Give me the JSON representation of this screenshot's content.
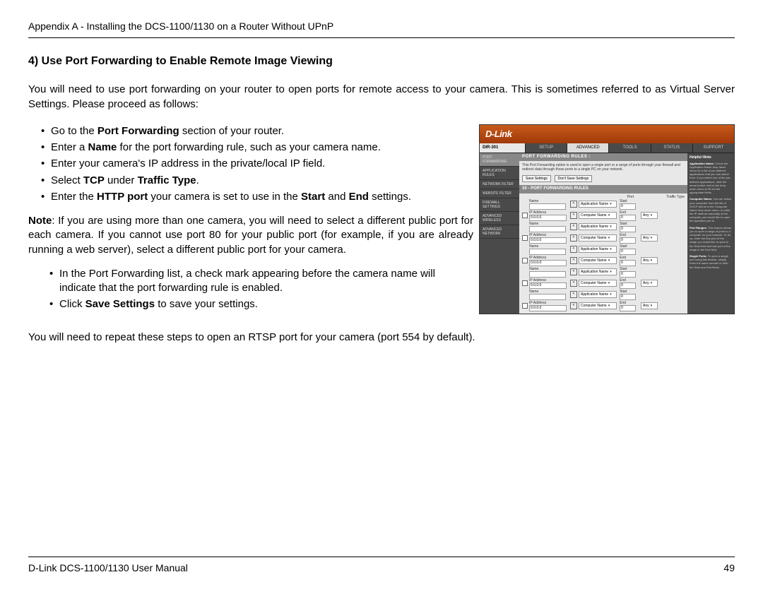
{
  "header": {
    "appendix": "Appendix A - Installing the DCS-1100/1130 on a Router Without UPnP"
  },
  "section": {
    "title": "4) Use Port Forwarding to Enable Remote Image Viewing",
    "intro": "You will need to use port forwarding on your router to open ports for remote access to your camera. This is sometimes referred to as Virtual Server Settings. Please proceed as follows:",
    "b1_pre": "Go to the ",
    "b1_bold": "Port Forwarding",
    "b1_post": " section of your router.",
    "b2_pre": "Enter a ",
    "b2_bold": "Name",
    "b2_post": " for the port forwarding rule, such as your camera name.",
    "b3": "Enter your camera's IP address in the private/local IP field.",
    "b4_pre": "Select ",
    "b4_bold1": "TCP",
    "b4_mid": " under ",
    "b4_bold2": "Traffic Type",
    "b4_post": ".",
    "b5_pre": "Enter the ",
    "b5_bold1": "HTTP port",
    "b5_mid": " your camera is set to use in the ",
    "b5_bold2": "Start",
    "b5_and": " and ",
    "b5_bold3": "End",
    "b5_post": " settings.",
    "note_bold": "Note",
    "note_body": ": If you are using more than one camera, you will need to select a different public port for each camera. If you cannot use port 80 for your public port (for example, if you are already running a web server), select a different public port for your camera.",
    "b6": "In the Port Forwarding list, a check mark appearing before the camera name will indicate that the port forwarding rule is enabled.",
    "b7_pre": "Click ",
    "b7_bold": "Save Settings",
    "b7_post": " to save your settings.",
    "outro": "You will need to repeat these steps to open an RTSP port for your camera (port 554 by default)."
  },
  "router": {
    "logo": "D-Link",
    "model": "DIR-301",
    "tabs": [
      "SETUP",
      "ADVANCED",
      "TOOLS",
      "STATUS",
      "SUPPORT"
    ],
    "sidebar": [
      "PORT FORWARDING",
      "APPLICATION RULES",
      "NETWORK FILTER",
      "WEBSITE FILTER",
      "FIREWALL SETTINGS",
      "ADVANCED WIRELESS",
      "ADVANCED NETWORK"
    ],
    "pf_title": "PORT FORWARDING RULES :",
    "pf_desc": "This Port Forwarding option is used to open a single port or a range of ports through your firewall and redirect data through those ports to a single PC on your network.",
    "save_btn": "Save Settings",
    "dont_btn": "Don't Save Settings",
    "rules_title": "10 - PORT FORWARDING RULES",
    "col_port": "Port",
    "col_traffic": "Traffic Type",
    "name_lbl": "Name",
    "ip_lbl": "IP Address",
    "ip_val": "0.0.0.0",
    "app_sel": "Application Name",
    "comp_sel": "Computer Name",
    "start_lbl": "Start",
    "end_lbl": "End",
    "zero": "0",
    "any": "Any",
    "help_title": "Helpful Hints",
    "help1_t": "Application Name:",
    "help1_b": "Check the Application Name drop down menu for a list of pre-defined applications that you can select from. If you select one of the pre-defined applications, click the arrow button next to the drop down menu to fill out the appropriate fields.",
    "help2_t": "Computer Name:",
    "help2_b": "You can select your computer from the list of DHCP clients in the Computer Name drop down menu, or enter the IP address manually of the computer you would like to open the specified port to.",
    "help3_t": "Port Ranges:",
    "help3_b": "This feature allows you to open a range of ports to a computer on your network. To do so, enter the first port of the range you would like to open in the Start field and last port of the range in the End field.",
    "help4_t": "Single Ports:",
    "help4_b": "To open a single port using this feature, simply enter the same number in both the Start and End fields."
  },
  "footer": {
    "left": "D-Link DCS-1100/1130 User Manual",
    "right": "49"
  }
}
